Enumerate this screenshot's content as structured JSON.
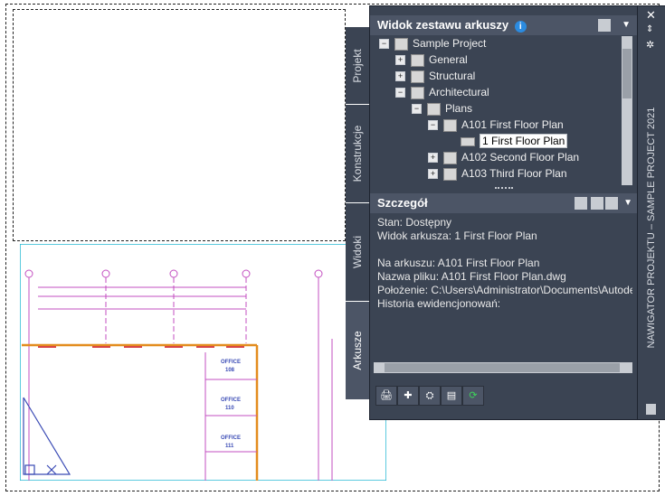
{
  "palette": {
    "vertical_title": "NAWIGATOR PROJEKTU – SAMPLE PROJECT 2021",
    "tabs": [
      "Projekt",
      "Konstrukcje",
      "Widoki",
      "Arkusze"
    ],
    "sheet_set_header": "Widok zestawu arkuszy",
    "details_header": "Szczegół",
    "tree": [
      {
        "label": "Sample Project",
        "level": 0,
        "expander": "−"
      },
      {
        "label": "General",
        "level": 1,
        "expander": "+"
      },
      {
        "label": "Structural",
        "level": 1,
        "expander": "+"
      },
      {
        "label": "Architectural",
        "level": 1,
        "expander": "−"
      },
      {
        "label": "Plans",
        "level": 2,
        "expander": "−"
      },
      {
        "label": "A101 First Floor Plan",
        "level": 3,
        "expander": "−"
      },
      {
        "label": "1 First Floor Plan",
        "level": 4,
        "expander": "",
        "selected": true
      },
      {
        "label": "A102 Second Floor Plan",
        "level": 3,
        "expander": "+"
      },
      {
        "label": "A103 Third Floor Plan",
        "level": 3,
        "expander": "+"
      }
    ],
    "details": {
      "line1": "Stan: Dostępny",
      "line2": "Widok arkusza: 1 First Floor Plan",
      "line3": "Na arkuszu: A101 First Floor Plan",
      "line4": "Nazwa pliku: A101 First Floor Plan.dwg",
      "line5": "Położenie: C:\\Users\\Administrator\\Documents\\Autodesk",
      "line6": "Historia ewidencjonowań:"
    }
  },
  "drawing": {
    "office_labels": [
      "OFFICE",
      "OFFICE",
      "OFFICE"
    ],
    "office_numbers": [
      "108",
      "110",
      "111"
    ]
  }
}
